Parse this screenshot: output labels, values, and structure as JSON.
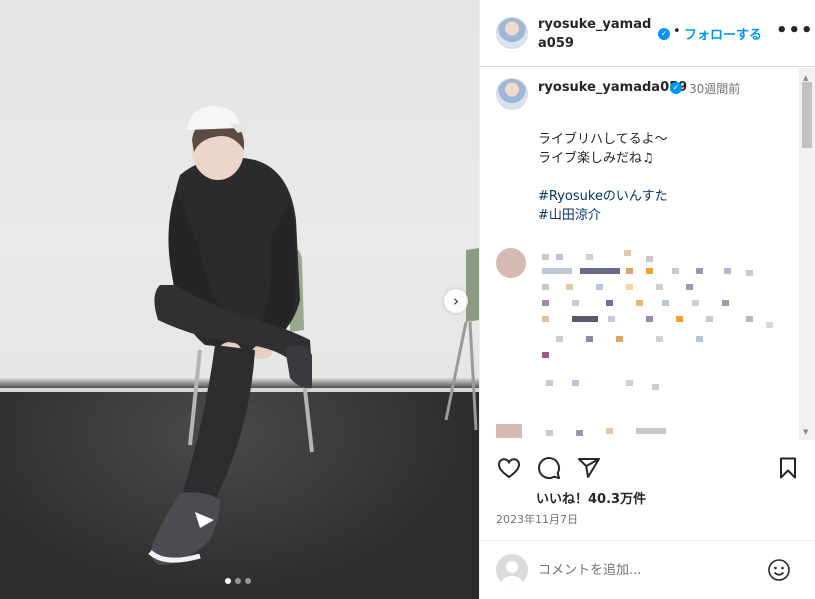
{
  "post": {
    "username_header": "ryosuke_yamada059",
    "dot_separator": "•",
    "follow_label": "フォローする",
    "more_label": "•••",
    "author": "ryosuke_yamada059",
    "time_ago": "30週間前",
    "caption_lines": [
      "ライブリハしてるよ〜",
      "ライブ楽しみだね♫"
    ],
    "hashtags": [
      "#Ryosukeのいんすた",
      "#山田涼介"
    ],
    "likes": "いいね！40.3万件",
    "date": "2023年11月7日",
    "comment_placeholder": "コメントを追加...",
    "carousel": {
      "total": 3,
      "active": 0
    }
  },
  "icons": {
    "verified": "verified-badge-icon",
    "like": "heart-icon",
    "comment": "comment-bubble-icon",
    "share": "paper-plane-icon",
    "save": "bookmark-icon",
    "emoji": "smiley-icon",
    "next": "chevron-right-icon"
  },
  "colors": {
    "accent": "#0095f6",
    "text": "#262626",
    "muted": "#737373",
    "hashtag": "#00376b"
  }
}
